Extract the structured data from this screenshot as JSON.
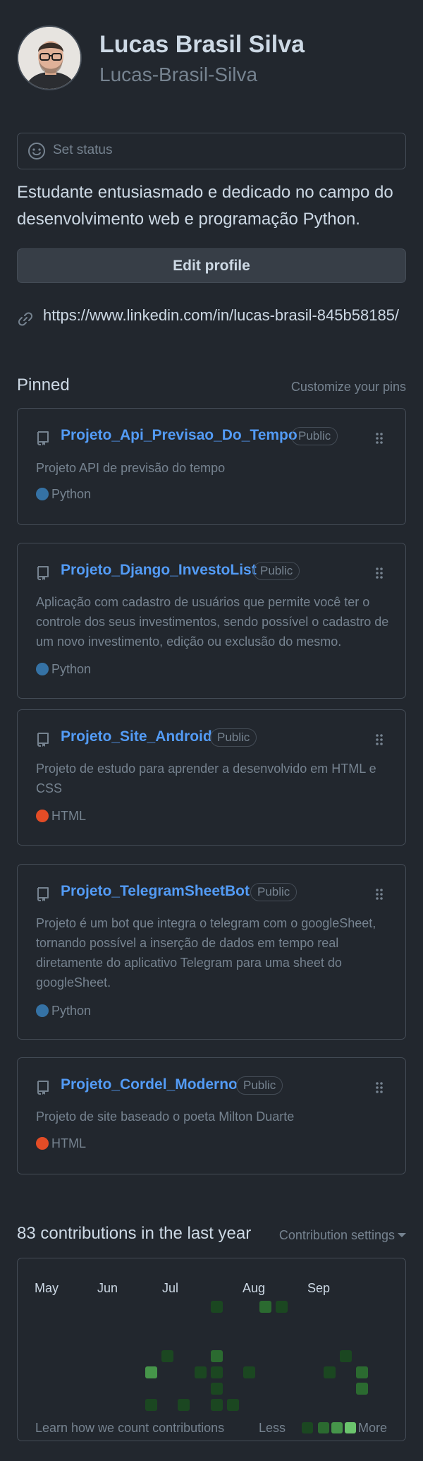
{
  "profile": {
    "full_name": "Lucas Brasil Silva",
    "username": "Lucas-Brasil-Silva",
    "set_status": "Set status",
    "bio": "Estudante entusiasmado e dedicado no campo do desenvolvimento web e programação Python.",
    "edit_profile": "Edit profile",
    "link": "https://www.linkedin.com/in/lucas-brasil-845b58185/"
  },
  "pinned": {
    "title": "Pinned",
    "customize": "Customize your pins",
    "repos": [
      {
        "name": "Projeto_Api_Previsao_Do_Tempo",
        "visibility": "Public",
        "description": "Projeto API de previsão do tempo",
        "language": "Python",
        "language_color": "#3572A5"
      },
      {
        "name": "Projeto_Django_InvestoList",
        "visibility": "Public",
        "description": "Aplicação com cadastro de usuários que permite você ter o controle dos seus investimentos, sendo possível o cadastro de um novo investimento, edição ou exclusão do mesmo.",
        "language": "Python",
        "language_color": "#3572A5"
      },
      {
        "name": "Projeto_Site_Android",
        "visibility": "Public",
        "description": "Projeto de estudo para aprender a desenvolvido em HTML e CSS",
        "language": "HTML",
        "language_color": "#e34c26"
      },
      {
        "name": "Projeto_TelegramSheetBot",
        "visibility": "Public",
        "description": "Projeto é um bot que integra o telegram com o googleSheet, tornando possível a inserção de dados em tempo real diretamente do aplicativo Telegram para uma sheet do googleSheet.",
        "language": "Python",
        "language_color": "#3572A5"
      },
      {
        "name": "Projeto_Cordel_Moderno",
        "visibility": "Public",
        "description": "Projeto de site baseado o poeta Milton Duarte",
        "language": "HTML",
        "language_color": "#e34c26"
      }
    ]
  },
  "contributions": {
    "title": "83 contributions in the last year",
    "settings": "Contribution settings",
    "months": [
      "May",
      "Jun",
      "Jul",
      "Aug",
      "Sep"
    ],
    "learn": "Learn how we count contributions",
    "less": "Less",
    "more": "More",
    "colors": {
      "l1": "#1b4721",
      "l2": "#2b6a30",
      "l3": "#46954a",
      "l4": "#6bc46d"
    }
  }
}
